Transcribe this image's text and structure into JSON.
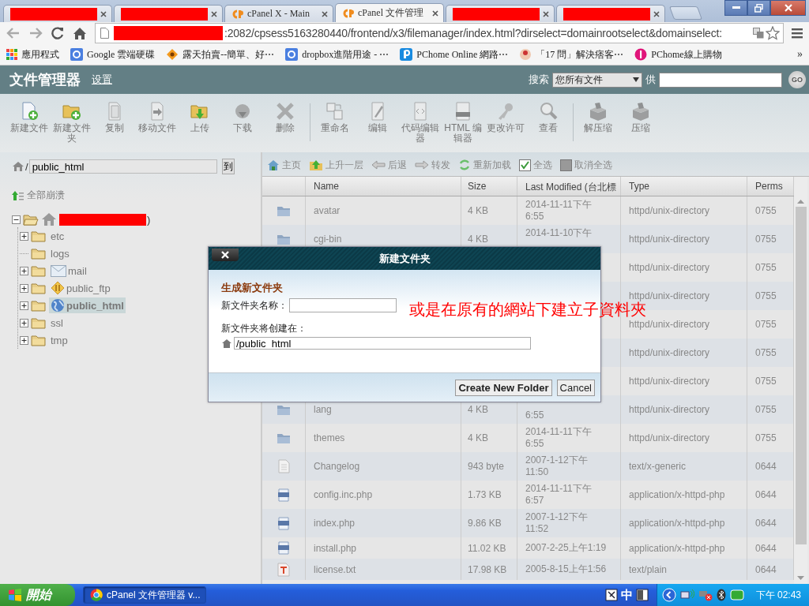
{
  "browser": {
    "tabs": [
      {
        "kind": "redacted",
        "selected": false
      },
      {
        "kind": "redacted",
        "selected": false
      },
      {
        "kind": "cpanel",
        "title": "cPanel X - Main",
        "selected": false
      },
      {
        "kind": "cpanel",
        "title": "cPanel 文件管理",
        "selected": true
      },
      {
        "kind": "redacted",
        "selected": false
      },
      {
        "kind": "redacted",
        "selected": false
      }
    ],
    "address": {
      "redacted": true,
      "url": ":2082/cpsess5163280440/frontend/x3/filemanager/index.html?dirselect=domainrootselect&domainselect:"
    },
    "bookmarks": [
      {
        "kind": "apps",
        "label": "應用程式"
      },
      {
        "kind": "google",
        "label": "Google 雲端硬碟"
      },
      {
        "kind": "ruten",
        "label": "露天拍賣--簡單、好⋯"
      },
      {
        "kind": "google",
        "label": "dropbox進階用途 - ⋯"
      },
      {
        "kind": "pchome",
        "label": "PChome Online 網路⋯"
      },
      {
        "kind": "avatar",
        "label": "「17 問」解決痞客⋯"
      },
      {
        "kind": "pchome-shop",
        "label": "PChome線上購物"
      }
    ],
    "bookmarks_more": "»"
  },
  "header": {
    "title": "文件管理器",
    "settings_link": "设置",
    "search_label": "搜索",
    "search_scope": "您所有文件",
    "for_label": "供",
    "go": "GO"
  },
  "toolbar": {
    "groups": [
      [
        {
          "kind": "new-file",
          "label": "新建文件",
          "disabled": false
        },
        {
          "kind": "new-folder",
          "label": "新建文件夹",
          "disabled": false
        },
        {
          "kind": "copy",
          "label": "复制",
          "disabled": true
        },
        {
          "kind": "move",
          "label": "移动文件",
          "disabled": true
        },
        {
          "kind": "upload",
          "label": "上传",
          "disabled": false
        },
        {
          "kind": "download",
          "label": "下载",
          "disabled": true
        },
        {
          "kind": "delete",
          "label": "删除",
          "disabled": true
        }
      ],
      [
        {
          "kind": "rename",
          "label": "重命名",
          "disabled": true
        },
        {
          "kind": "edit",
          "label": "编辑",
          "disabled": true
        },
        {
          "kind": "code",
          "label": "代码编辑器",
          "disabled": true
        },
        {
          "kind": "html",
          "label": "HTML 编辑器",
          "disabled": true
        },
        {
          "kind": "permissions",
          "label": "更改许可",
          "disabled": true
        },
        {
          "kind": "view",
          "label": "查看",
          "disabled": true
        }
      ],
      [
        {
          "kind": "extract",
          "label": "解压缩",
          "disabled": true
        },
        {
          "kind": "compress",
          "label": "压缩",
          "disabled": true
        }
      ]
    ]
  },
  "file_panel": {
    "path_prefix": "/",
    "path": "public_html",
    "go_button": "到",
    "collapse_all": "全部崩溃",
    "tree": {
      "label": ")",
      "redacted": true,
      "expanded": true,
      "children": [
        {
          "label": "etc",
          "kind": "folder",
          "expandable": true,
          "selected": false
        },
        {
          "label": "logs",
          "kind": "folder",
          "expandable": false,
          "selected": false
        },
        {
          "label": "mail",
          "kind": "mail",
          "expandable": true,
          "selected": false
        },
        {
          "label": "public_ftp",
          "kind": "ftp",
          "expandable": true,
          "selected": false
        },
        {
          "label": "public_html",
          "kind": "web",
          "expandable": true,
          "selected": true
        },
        {
          "label": "ssl",
          "kind": "folder",
          "expandable": true,
          "selected": false
        },
        {
          "label": "tmp",
          "kind": "folder",
          "expandable": true,
          "selected": false
        }
      ]
    }
  },
  "nav": [
    {
      "kind": "home",
      "label": "主页"
    },
    {
      "kind": "up",
      "label": "上升一层"
    },
    {
      "kind": "back",
      "label": "后退"
    },
    {
      "kind": "forward",
      "label": "转发"
    },
    {
      "kind": "reload",
      "label": "重新加载"
    },
    {
      "kind": "check",
      "label": "全选",
      "checked": true
    },
    {
      "kind": "check",
      "label": "取消全选",
      "checked": false
    }
  ],
  "table": {
    "columns": [
      "Name",
      "Size",
      "Last Modified (台北標",
      "Type",
      "Perms"
    ],
    "rows": [
      {
        "kind": "folder",
        "name": "avatar",
        "size": "4 KB",
        "modified": [
          "2014-11-11下午",
          "6:55"
        ],
        "type": "httpd/unix-directory",
        "perms": "0755"
      },
      {
        "kind": "folder",
        "name": "cgi-bin",
        "size": "4 KB",
        "modified": [
          "2014-11-10下午"
        ],
        "type": "httpd/unix-directory",
        "perms": "0755"
      },
      {
        "kind": "hidden",
        "type": "httpd/unix-directory",
        "perms": "0755"
      },
      {
        "kind": "hidden",
        "type": "httpd/unix-directory",
        "perms": "0755"
      },
      {
        "kind": "hidden",
        "type": "httpd/unix-directory",
        "perms": "0755"
      },
      {
        "kind": "hidden",
        "type": "httpd/unix-directory",
        "perms": "0755"
      },
      {
        "kind": "hidden",
        "type": "httpd/unix-directory",
        "perms": "0755"
      },
      {
        "kind": "folder",
        "name": "lang",
        "size": "4 KB",
        "modified": [
          "6:55"
        ],
        "type": "httpd/unix-directory",
        "perms": "0755"
      },
      {
        "kind": "folder",
        "name": "themes",
        "size": "4 KB",
        "modified": [
          "2014-11-11下午",
          "6:55"
        ],
        "type": "httpd/unix-directory",
        "perms": "0755"
      },
      {
        "kind": "text",
        "name": "Changelog",
        "size": "943 byte",
        "modified": [
          "2007-1-12下午",
          "11:50"
        ],
        "type": "text/x-generic",
        "perms": "0644"
      },
      {
        "kind": "php",
        "name": "config.inc.php",
        "size": "1.73 KB",
        "modified": [
          "2014-11-11下午",
          "6:57"
        ],
        "type": "application/x-httpd-php",
        "perms": "0644"
      },
      {
        "kind": "php",
        "name": "index.php",
        "size": "9.86 KB",
        "modified": [
          "2007-1-12下午",
          "11:52"
        ],
        "type": "application/x-httpd-php",
        "perms": "0644"
      },
      {
        "kind": "php",
        "name": "install.php",
        "size": "11.02 KB",
        "modified": [
          "2007-2-25上午1:19"
        ],
        "type": "application/x-httpd-php",
        "perms": "0644"
      },
      {
        "kind": "plain",
        "name": "license.txt",
        "size": "17.98 KB",
        "modified": [
          "2005-8-15上午1:56"
        ],
        "type": "text/plain",
        "perms": "0644"
      }
    ]
  },
  "dialog": {
    "title": "新建文件夹",
    "heading": "生成新文件夹",
    "name_label": "新文件夹名称：",
    "location_label": "新文件夹将创建在：",
    "location": "/public_html",
    "buttons": [
      "Create New Folder",
      "Cancel"
    ]
  },
  "annotation": "或是在原有的網站下建立子資料夾",
  "taskbar": {
    "start": "開始",
    "windows": [
      {
        "title": "cPanel 文件管理器 v...",
        "selected": true
      }
    ],
    "ime": "中",
    "clock": "下午 02:43"
  }
}
